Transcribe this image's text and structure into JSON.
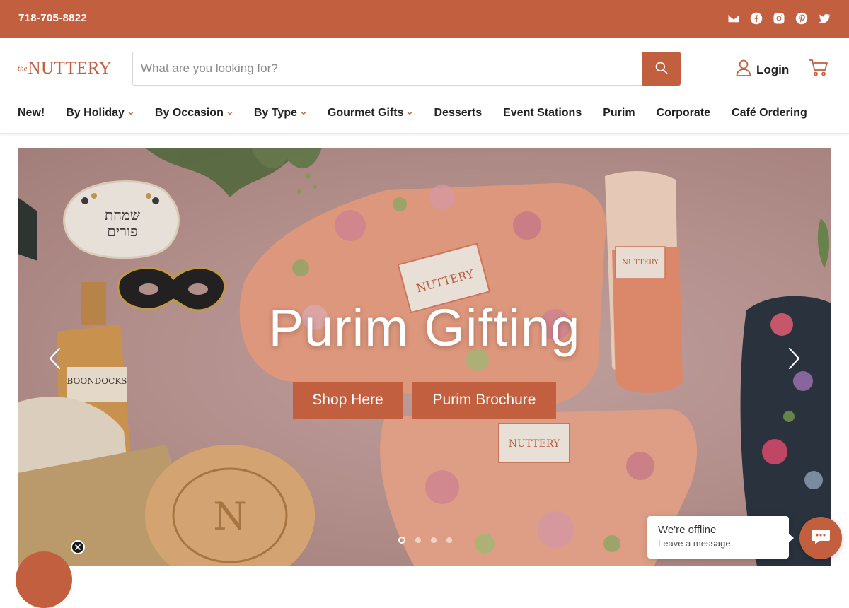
{
  "topbar": {
    "phone": "718-705-8822",
    "social_icons": [
      "email-icon",
      "facebook-icon",
      "instagram-icon",
      "pinterest-icon",
      "twitter-icon"
    ],
    "background": "#c25f3e"
  },
  "header": {
    "logo_prefix": "the",
    "logo_name": "NUTTERY",
    "search_placeholder": "What are you looking for?",
    "login_label": "Login"
  },
  "nav": {
    "items": [
      {
        "label": "New!",
        "dropdown": false
      },
      {
        "label": "By Holiday",
        "dropdown": true
      },
      {
        "label": "By Occasion",
        "dropdown": true
      },
      {
        "label": "By Type",
        "dropdown": true
      },
      {
        "label": "Gourmet Gifts",
        "dropdown": true
      },
      {
        "label": "Desserts",
        "dropdown": false
      },
      {
        "label": "Event Stations",
        "dropdown": false
      },
      {
        "label": "Purim",
        "dropdown": false
      },
      {
        "label": "Corporate",
        "dropdown": false
      },
      {
        "label": "Café Ordering",
        "dropdown": false
      }
    ]
  },
  "hero": {
    "title": "Purim Gifting",
    "buttons": [
      "Shop Here",
      "Purim Brochure"
    ],
    "slide_count": 4,
    "active_slide": 1
  },
  "chat": {
    "title": "We're offline",
    "subtitle": "Leave a message"
  },
  "colors": {
    "accent": "#c25f3e",
    "text": "#222222"
  }
}
